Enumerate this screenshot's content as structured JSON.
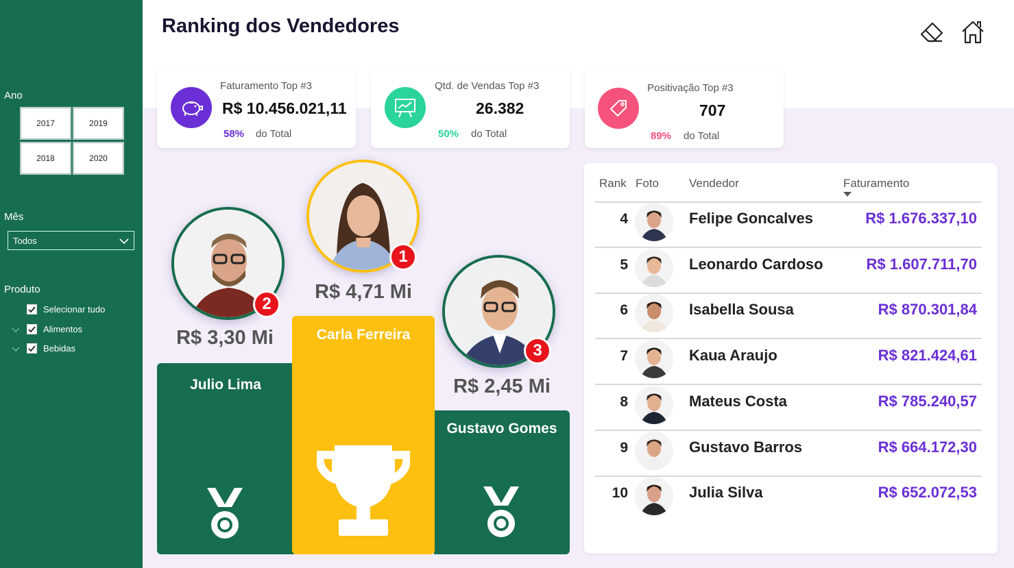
{
  "title": "Ranking dos Vendedores",
  "sidebar": {
    "year_label": "Ano",
    "years": [
      "2017",
      "2019",
      "2018",
      "2020"
    ],
    "month_label": "Mês",
    "month_value": "Todos",
    "product_label": "Produto",
    "products": [
      "Selecionar tudo",
      "Alimentos",
      "Bebidas"
    ]
  },
  "kpis": [
    {
      "label": "Faturamento Top #3",
      "value": "R$ 10.456.021,11",
      "pct": "58%",
      "total": "do Total",
      "color": "#6a2fd6",
      "icon": "piggy-bank-icon"
    },
    {
      "label": "Qtd. de Vendas Top #3",
      "value": "26.382",
      "pct": "50%",
      "total": "do Total",
      "color": "#2ad49b",
      "icon": "presentation-chart-icon"
    },
    {
      "label": "Positivação Top #3",
      "value": "707",
      "pct": "89%",
      "total": "do Total",
      "color": "#f5527c",
      "icon": "price-tag-icon"
    }
  ],
  "podium": {
    "first": {
      "rank": "1",
      "name": "Carla Ferreira",
      "value": "R$ 4,71 Mi"
    },
    "second": {
      "rank": "2",
      "name": "Julio Lima",
      "value": "R$ 3,30 Mi"
    },
    "third": {
      "rank": "3",
      "name": "Gustavo Gomes",
      "value": "R$ 2,45 Mi"
    }
  },
  "table": {
    "headers": {
      "rank": "Rank",
      "photo": "Foto",
      "seller": "Vendedor",
      "revenue": "Faturamento"
    },
    "rows": [
      {
        "rank": "4",
        "name": "Felipe Goncalves",
        "revenue": "R$ 1.676.337,10"
      },
      {
        "rank": "5",
        "name": "Leonardo Cardoso",
        "revenue": "R$ 1.607.711,70"
      },
      {
        "rank": "6",
        "name": "Isabella Sousa",
        "revenue": "R$ 870.301,84"
      },
      {
        "rank": "7",
        "name": "Kaua Araujo",
        "revenue": "R$ 821.424,61"
      },
      {
        "rank": "8",
        "name": "Mateus Costa",
        "revenue": "R$ 785.240,57"
      },
      {
        "rank": "9",
        "name": "Gustavo Barros",
        "revenue": "R$ 664.172,30"
      },
      {
        "rank": "10",
        "name": "Julia Silva",
        "revenue": "R$ 652.072,53"
      }
    ]
  },
  "colors": {
    "green": "#176d4f",
    "gold": "#fdc010",
    "purple": "#6a2fd6"
  }
}
